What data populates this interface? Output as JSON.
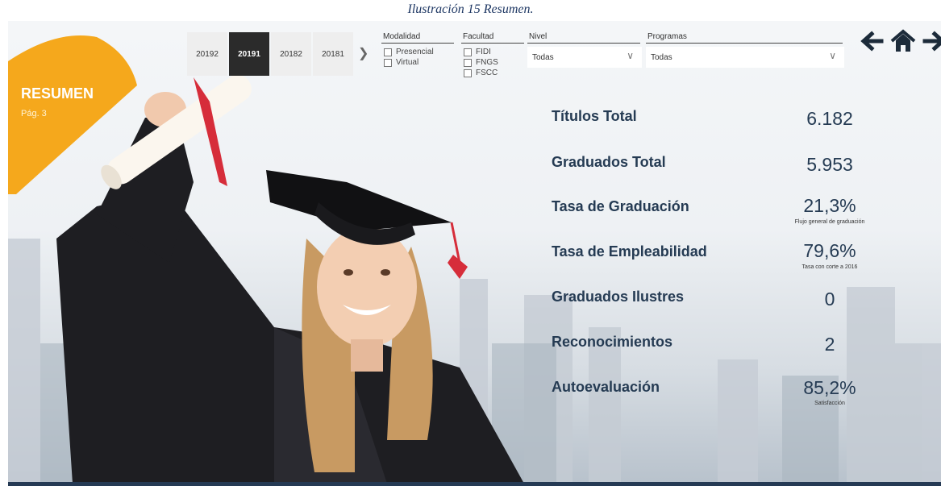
{
  "caption": "Ilustración 15 Resumen.",
  "tag": {
    "title": "RESUMEN",
    "page": "Pág. 3"
  },
  "periods": [
    "20192",
    "20191",
    "20182",
    "20181"
  ],
  "active_period": "20191",
  "filters": {
    "modalidad": {
      "label": "Modalidad",
      "options": [
        "Presencial",
        "Virtual"
      ]
    },
    "facultad": {
      "label": "Facultad",
      "options": [
        "FIDI",
        "FNGS",
        "FSCC"
      ]
    },
    "nivel": {
      "label": "Nivel",
      "value": "Todas"
    },
    "programas": {
      "label": "Programas",
      "value": "Todas"
    }
  },
  "nav": [
    "back-arrow-icon",
    "home-icon",
    "forward-arrow-icon"
  ],
  "kpis": [
    {
      "label": "Títulos Total",
      "value": "6.182",
      "note": ""
    },
    {
      "label": "Graduados Total",
      "value": "5.953",
      "note": ""
    },
    {
      "label": "Tasa de Graduación",
      "value": "21,3%",
      "note": "Flujo general de graduación"
    },
    {
      "label": "Tasa de Empleabilidad",
      "value": "79,6%",
      "note": "Tasa con corte a 2016"
    },
    {
      "label": "Graduados Ilustres",
      "value": "0",
      "note": ""
    },
    {
      "label": "Reconocimientos",
      "value": "2",
      "note": ""
    },
    {
      "label": "Autoevaluación",
      "value": "85,2%",
      "note": "Satisfacción"
    }
  ],
  "colors": {
    "accent": "#f5a81c",
    "text": "#253b53",
    "bar": "#253a54"
  }
}
